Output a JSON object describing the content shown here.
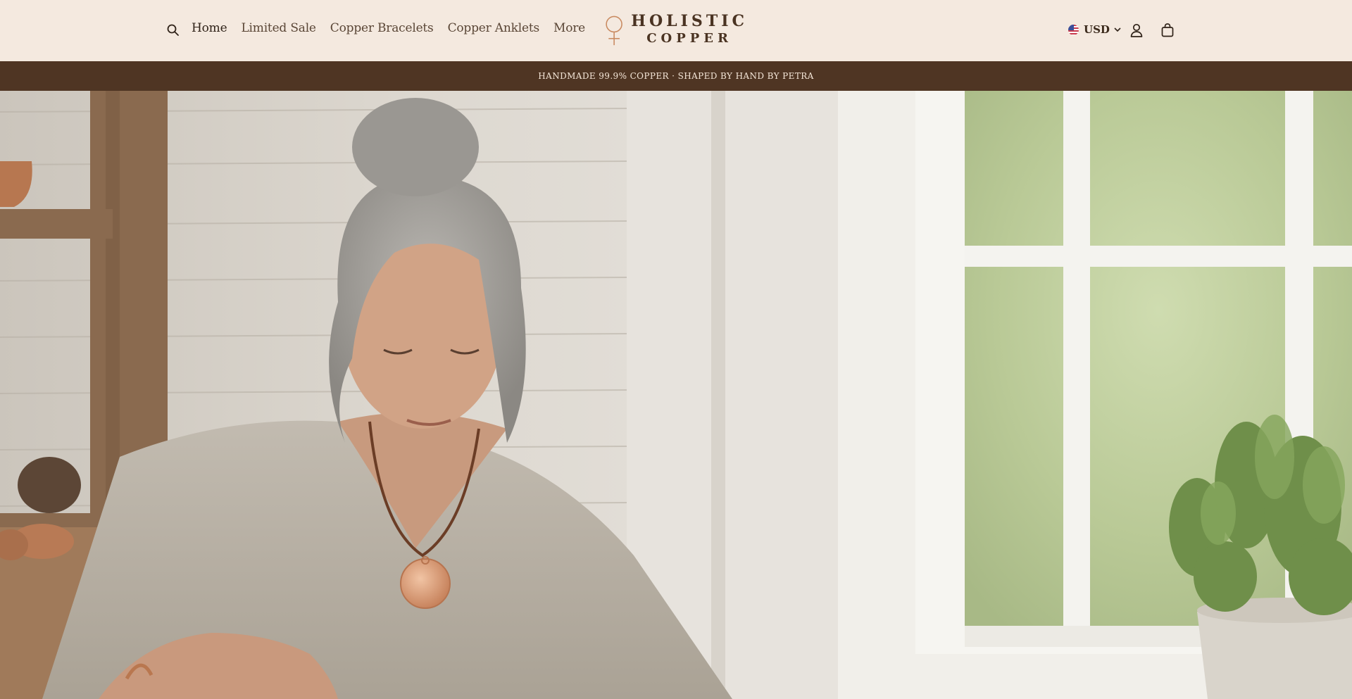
{
  "header": {
    "nav": {
      "home": "Home",
      "limited_sale": "Limited Sale",
      "copper_bracelets": "Copper Bracelets",
      "copper_anklets": "Copper Anklets",
      "more": "More"
    },
    "logo": {
      "line1": "HOLISTIC",
      "line2": "COPPER"
    },
    "currency": "USD",
    "icons": [
      "search-icon",
      "us-flag-icon",
      "chevron-down-icon",
      "account-icon",
      "cart-icon"
    ]
  },
  "announcement": "HANDMADE 99.9% COPPER · SHAPED BY HAND BY PETRA",
  "colors": {
    "header_bg": "#f4e9df",
    "announcement_bg": "#4f3523",
    "brand_text": "#4a3322",
    "copper": "#c98a60"
  }
}
